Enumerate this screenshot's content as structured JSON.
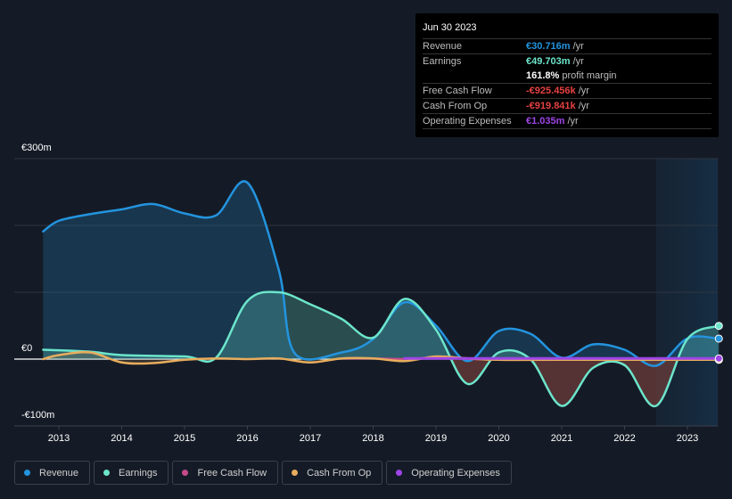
{
  "tooltip": {
    "date": "Jun 30 2023",
    "rows": [
      {
        "label": "Revenue",
        "value": "€30.716m",
        "unit": " /yr",
        "color": "#2394df"
      },
      {
        "label": "Earnings",
        "value": "€49.703m",
        "unit": " /yr",
        "color": "#6ce5cb"
      },
      {
        "label": "",
        "value": "161.8%",
        "unit": " profit margin",
        "color": "#ffffff"
      },
      {
        "label": "Free Cash Flow",
        "value": "-€925.456k",
        "unit": " /yr",
        "color": "#e64141"
      },
      {
        "label": "Cash From Op",
        "value": "-€919.841k",
        "unit": " /yr",
        "color": "#e64141"
      },
      {
        "label": "Operating Expenses",
        "value": "€1.035m",
        "unit": " /yr",
        "color": "#9e45e6"
      }
    ]
  },
  "legend": [
    {
      "label": "Revenue",
      "color": "#2394df"
    },
    {
      "label": "Earnings",
      "color": "#6ce5cb"
    },
    {
      "label": "Free Cash Flow",
      "color": "#c64a8a"
    },
    {
      "label": "Cash From Op",
      "color": "#e8ad5d"
    },
    {
      "label": "Operating Expenses",
      "color": "#9e45e6"
    }
  ],
  "chart_data": {
    "type": "area",
    "title": "",
    "xlabel": "",
    "ylabel": "",
    "currency": "EUR",
    "unit": "m",
    "ylim": [
      -100,
      300
    ],
    "y_ticks": [
      {
        "value": 300,
        "label": "€300m"
      },
      {
        "value": 0,
        "label": "€0"
      },
      {
        "value": -100,
        "label": "-€100m"
      }
    ],
    "x_ticks": [
      "2013",
      "2014",
      "2015",
      "2016",
      "2017",
      "2018",
      "2019",
      "2020",
      "2021",
      "2022",
      "2023"
    ],
    "xlim": [
      2012.75,
      2023.5
    ],
    "highlight_range": [
      2022.5,
      2023.5
    ],
    "grid": true,
    "legend_position": "bottom-left",
    "series": [
      {
        "name": "Revenue",
        "color": "#2394df",
        "x": [
          2012.75,
          2013.0,
          2013.5,
          2014.0,
          2014.5,
          2015.0,
          2015.5,
          2016.0,
          2016.5,
          2016.75,
          2017.5,
          2018.0,
          2018.5,
          2019.0,
          2019.5,
          2020.0,
          2020.5,
          2021.0,
          2021.5,
          2022.0,
          2022.5,
          2023.0,
          2023.5
        ],
        "values": [
          191,
          207,
          217,
          224,
          232,
          218,
          215,
          264,
          133,
          9,
          10,
          30,
          85,
          50,
          -3,
          42,
          38,
          2,
          22,
          14,
          -10,
          31,
          30.716
        ]
      },
      {
        "name": "Earnings",
        "color": "#6ce5cb",
        "x": [
          2012.75,
          2013.5,
          2014.0,
          2015.0,
          2015.5,
          2016.0,
          2016.5,
          2017.0,
          2017.5,
          2018.0,
          2018.5,
          2019.0,
          2019.5,
          2020.0,
          2020.5,
          2021.0,
          2021.5,
          2022.0,
          2022.5,
          2023.0,
          2023.5
        ],
        "values": [
          14,
          11,
          6,
          4,
          2,
          87,
          100,
          82,
          60,
          32,
          90,
          44,
          -37,
          10,
          0,
          -70,
          -13,
          -9,
          -70,
          30,
          49.703
        ]
      },
      {
        "name": "Free Cash Flow",
        "color": "#c64a8a",
        "x": [
          2017.5,
          2018.0,
          2018.5,
          2019.0,
          2020.0,
          2021.0,
          2022.0,
          2023.0,
          2023.5
        ],
        "values": [
          1,
          1,
          0,
          2,
          -1,
          -1,
          -1,
          -1,
          -0.925
        ]
      },
      {
        "name": "Cash From Op",
        "color": "#e8ad5d",
        "x": [
          2012.75,
          2013.0,
          2013.5,
          2014.0,
          2014.5,
          2015.0,
          2015.5,
          2016.0,
          2016.5,
          2017.0,
          2017.5,
          2018.0,
          2018.5,
          2019.0,
          2019.5,
          2020.0,
          2021.0,
          2022.0,
          2023.0,
          2023.5
        ],
        "values": [
          0,
          6,
          10,
          -5,
          -6,
          -1,
          1,
          0,
          1,
          -5,
          1,
          1,
          -3,
          4,
          1,
          -1,
          -1,
          -1,
          -1,
          -0.92
        ]
      },
      {
        "name": "Operating Expenses",
        "color": "#9e45e6",
        "x": [
          2018.5,
          2019.0,
          2020.0,
          2021.0,
          2022.0,
          2023.0,
          2023.5
        ],
        "values": [
          1,
          1,
          1,
          1,
          1,
          1,
          1.035
        ]
      }
    ]
  }
}
